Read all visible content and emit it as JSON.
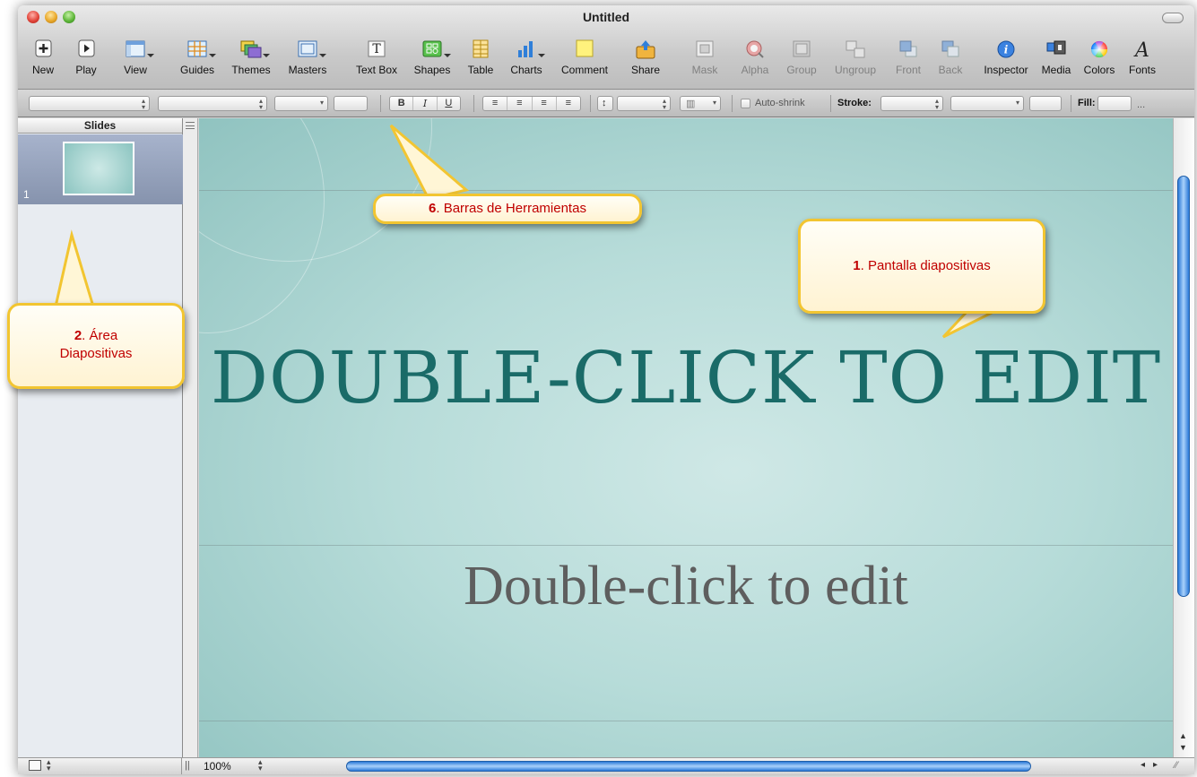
{
  "window": {
    "title": "Untitled"
  },
  "toolbar": {
    "items": [
      {
        "label": "New",
        "icon": "new-icon",
        "enabled": true
      },
      {
        "label": "Play",
        "icon": "play-icon",
        "enabled": true
      },
      {
        "label": "View",
        "icon": "view-icon",
        "enabled": true
      },
      {
        "label": "Guides",
        "icon": "guides-icon",
        "enabled": true
      },
      {
        "label": "Themes",
        "icon": "themes-icon",
        "enabled": true
      },
      {
        "label": "Masters",
        "icon": "masters-icon",
        "enabled": true
      },
      {
        "label": "Text Box",
        "icon": "text-box-icon",
        "enabled": true
      },
      {
        "label": "Shapes",
        "icon": "shapes-icon",
        "enabled": true
      },
      {
        "label": "Table",
        "icon": "table-icon",
        "enabled": true
      },
      {
        "label": "Charts",
        "icon": "charts-icon",
        "enabled": true
      },
      {
        "label": "Comment",
        "icon": "comment-icon",
        "enabled": true
      },
      {
        "label": "Share",
        "icon": "share-icon",
        "enabled": true
      },
      {
        "label": "Mask",
        "icon": "mask-icon",
        "enabled": false
      },
      {
        "label": "Alpha",
        "icon": "alpha-icon",
        "enabled": false
      },
      {
        "label": "Group",
        "icon": "group-icon",
        "enabled": false
      },
      {
        "label": "Ungroup",
        "icon": "ungroup-icon",
        "enabled": false
      },
      {
        "label": "Front",
        "icon": "front-icon",
        "enabled": false
      },
      {
        "label": "Back",
        "icon": "back-icon",
        "enabled": false
      },
      {
        "label": "Inspector",
        "icon": "inspector-icon",
        "enabled": true
      },
      {
        "label": "Media",
        "icon": "media-icon",
        "enabled": true
      },
      {
        "label": "Colors",
        "icon": "colors-icon",
        "enabled": true
      },
      {
        "label": "Fonts",
        "icon": "fonts-icon",
        "enabled": true
      }
    ]
  },
  "format_bar": {
    "bold": "B",
    "italic": "I",
    "underline": "U",
    "auto_shrink": "Auto-shrink",
    "stroke_label": "Stroke:",
    "fill_label": "Fill:",
    "more": "..."
  },
  "slides_panel": {
    "header": "Slides",
    "slides": [
      {
        "number": "1"
      }
    ]
  },
  "slide": {
    "title": "DOUBLE-CLICK TO EDIT",
    "subtitle": "Double-click to edit"
  },
  "status": {
    "zoom": "100%"
  },
  "callouts": {
    "toolbars": {
      "num": "6",
      "text": ". Barras de Herramientas"
    },
    "slide_screen": {
      "num": "1",
      "text": ". Pantalla diapositivas"
    },
    "slides_area": {
      "num": "2",
      "line1": ". Área",
      "line2": "Diapositivas"
    }
  },
  "colors": {
    "accent": "#1a6b68",
    "callout_border": "#f2c531",
    "callout_text": "#c00000"
  }
}
